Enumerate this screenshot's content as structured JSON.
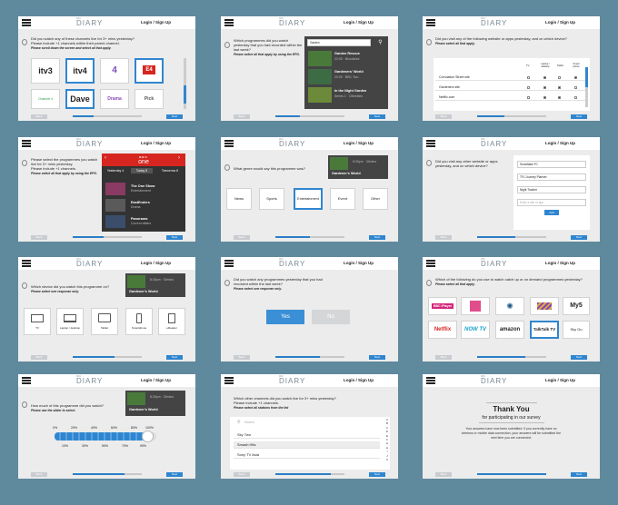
{
  "header": {
    "logo_small": "Chi",
    "logo_big": "DIARY",
    "login": "Login / Sign Up"
  },
  "nav": {
    "back": "Back",
    "next": "Next"
  },
  "s1": {
    "question": "Did you watch any of these channels live for 3+ mins yesterday?",
    "sub": "Please include +1 channels within their parent channel.",
    "instruction": "Please scroll down the screen and select all that apply.",
    "channels": [
      "itv3",
      "itv4",
      "4",
      "E4",
      "Channel 4",
      "Dave",
      "Drama",
      "Pick"
    ],
    "progress": 0.3
  },
  "s2": {
    "question": "Which programmes did you watch yesterday that you had recorded within the last week?",
    "instruction": "Please select all that apply by using the EPG.",
    "search": "Garden",
    "results": [
      {
        "title": "Garden Rescue",
        "meta": "22:00 · Bloodshot"
      },
      {
        "title": "Gardeners' World",
        "meta": "20:00 · BBC Two"
      },
      {
        "title": "In the Night Garden",
        "meta": "Series 1 · CBeebies"
      }
    ],
    "progress": 0.35
  },
  "s3": {
    "question": "Did you visit any of the following website or apps yesterday, and on which device?",
    "instruction": "Please select all that apply.",
    "columns": [
      "TV",
      "Laptop / desktop",
      "Tablet",
      "Smart phone"
    ],
    "rows": [
      {
        "label": "Coronation Street site",
        "checks": [
          false,
          true,
          false,
          true
        ]
      },
      {
        "label": "Gardeners site",
        "checks": [
          false,
          true,
          true,
          false
        ]
      },
      {
        "label": "Netflix.com",
        "checks": [
          false,
          true,
          true,
          false
        ]
      }
    ],
    "progress": 0.4
  },
  "s4": {
    "question": "Please select the programmes you watch live for 3+ mins yesterday.",
    "sub": "Please include +1 channels.",
    "instruction": "Please select all that apply by using the EPG.",
    "channel": "one",
    "days": [
      "Yesterday 4",
      "Today 5",
      "Tomorrow 6"
    ],
    "items": [
      {
        "title": "The One Show",
        "meta": "Entertainment"
      },
      {
        "title": "EastEnders",
        "meta": "Drama"
      },
      {
        "title": "Panorama",
        "meta": "Current affairs"
      }
    ],
    "progress": 0.45
  },
  "s5": {
    "question": "What genre would say this programme was?",
    "prog_title": "Gardener's World",
    "prog_meta": "8:30pm · 30mins",
    "genres": [
      "News",
      "Sports",
      "Entertainment",
      "Event",
      "Other"
    ],
    "progress": 0.5
  },
  "s6": {
    "question": "Did you visit any other website or apps yesterday, and on which device?",
    "fields": [
      "Snowflake FC",
      "TFL Journey Planner",
      "Night Tracker",
      "Enter a site or app"
    ],
    "add": "Add",
    "progress": 0.55
  },
  "s7": {
    "question": "Which device did you watch this programme on?",
    "instruction": "Please select one response only.",
    "prog_title": "Gardener's World",
    "prog_meta": "8:30pm · 30mins",
    "devices": [
      "TV",
      "Laptop / desktop",
      "Tablet",
      "Smartphone",
      "eReader"
    ],
    "progress": 0.6
  },
  "s8": {
    "question": "Did you watch any programmes yesterday that you had recorded within the last week?",
    "instruction": "Please select one response only.",
    "yes": "Yes",
    "no": "No",
    "progress": 0.65
  },
  "s9": {
    "question": "Which of the following do you use to watch catch up or on demand programmes yesterday?",
    "instruction": "Please select all that apply.",
    "services": [
      "BBC iPlayer",
      "Channel 4",
      "Sky",
      "Channel 5 Player",
      "My5",
      "Netflix",
      "NOW TV",
      "amazon",
      "TalkTalk TV",
      "Sky Go"
    ],
    "progress": 0.7
  },
  "s10": {
    "question": "How much of this programme did you watch?",
    "instruction": "Please use the slider to select.",
    "prog_title": "Gardener's World",
    "prog_meta": "8:30pm · 30mins",
    "top_labels": [
      "0%",
      "20%",
      "40%",
      "60%",
      "80%",
      "100%"
    ],
    "bottom_labels": [
      "10%",
      "30%",
      "50%",
      "70%",
      "90%"
    ],
    "value": 0.9,
    "progress": 0.75
  },
  "s11": {
    "question": "Which other channels did you watch live for 3+ mins yesterday?",
    "sub": "Please include +1 channels.",
    "instruction": "Please select all stations from the list",
    "search": "Search",
    "channels": [
      "Sky Two",
      "Smash Hits",
      "Sony TV Asia"
    ],
    "alphabet": [
      "A",
      "B",
      "C",
      "D",
      "E",
      "F",
      "G",
      "H",
      "I",
      "J",
      "K"
    ],
    "progress": 0.8
  },
  "s12": {
    "title": "Thank You",
    "subtitle": "for participating in our survey",
    "body": "Your answers have now been submitted. If you currently have no wireless or mobile data connection, your answers will be submitted the next time you are connected.",
    "progress": 1.0
  },
  "colors": {
    "bg": "#5f899d",
    "accent": "#2f86d0",
    "bbc_red": "#d6261f"
  }
}
